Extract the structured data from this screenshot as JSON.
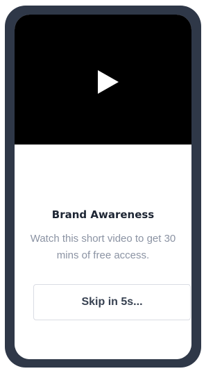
{
  "ad": {
    "title": "Brand Awareness",
    "description": "Watch this short video to get 30 mins of free access.",
    "skip_label": "Skip in 5s..."
  },
  "video": {
    "icon": "play-icon",
    "background_color": "#000000"
  },
  "colors": {
    "frame": "#2f3848",
    "title": "#1d2533",
    "description": "#8b93a3",
    "button_border": "#d9dce3"
  }
}
